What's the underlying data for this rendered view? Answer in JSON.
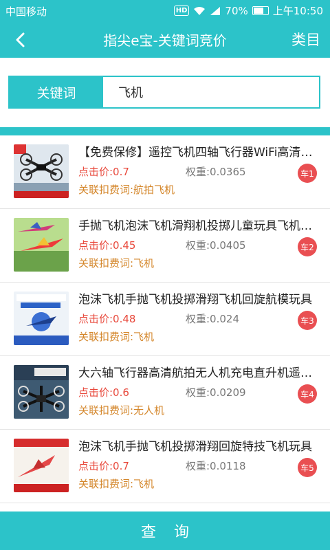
{
  "status_bar": {
    "carrier": "中国移动",
    "hd": "HD",
    "battery": "70%",
    "time": "上午10:50"
  },
  "nav": {
    "title": "指尖e宝-关键词竞价",
    "category_label": "类目"
  },
  "search": {
    "label": "关键词",
    "value": "飞机"
  },
  "items": [
    {
      "title": "【免费保修】遥控飞机四轴飞行器WiFi高清航拍无人机",
      "price": "点击价:0.7",
      "weight": "权重:0.0365",
      "related": "关联扣费词:航拍飞机",
      "badge": "车1"
    },
    {
      "title": "手抛飞机泡沫飞机滑翔机投掷儿童玩具飞机模型",
      "price": "点击价:0.45",
      "weight": "权重:0.0405",
      "related": "关联扣费词:飞机",
      "badge": "车2"
    },
    {
      "title": "泡沫飞机手抛飞机投掷滑翔飞机回旋航模玩具",
      "price": "点击价:0.48",
      "weight": "权重:0.024",
      "related": "关联扣费词:飞机",
      "badge": "车3"
    },
    {
      "title": "大六轴飞行器高清航拍无人机充电直升机遥控飞机",
      "price": "点击价:0.6",
      "weight": "权重:0.0209",
      "related": "关联扣费词:无人机",
      "badge": "车4"
    },
    {
      "title": "泡沫飞机手抛飞机投掷滑翔回旋特技飞机玩具",
      "price": "点击价:0.7",
      "weight": "权重:0.0118",
      "related": "关联扣费词:飞机",
      "badge": "车5"
    }
  ],
  "bottom": {
    "query_label": "查询"
  },
  "colors": {
    "accent": "#2cc3c9",
    "price": "#e8473a",
    "related": "#d4862a",
    "badge": "#e94f52"
  }
}
